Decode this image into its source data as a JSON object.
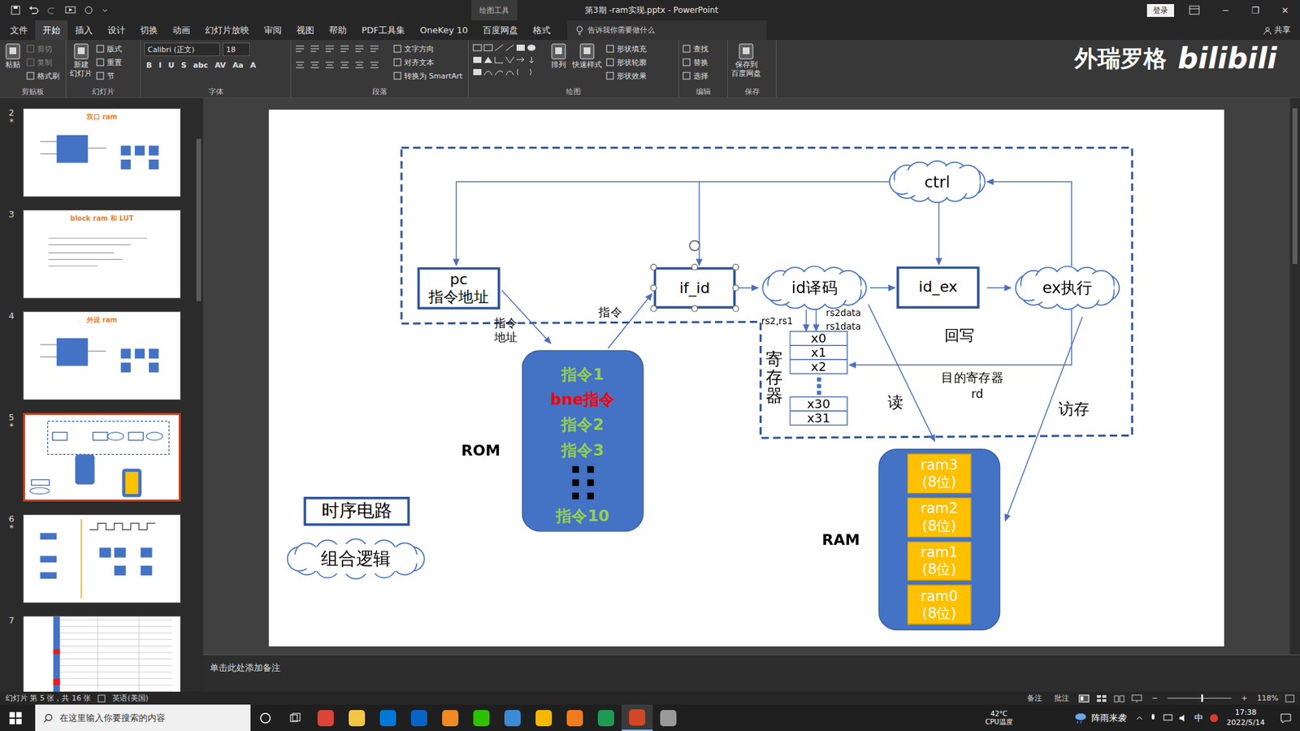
{
  "window": {
    "title": "第3期 -ram实现.pptx - PowerPoint",
    "context_tab": "绘图工具",
    "login": "登录",
    "controls": [
      "─",
      "❐",
      "✕"
    ]
  },
  "tabs": [
    {
      "label": "文件",
      "selected": false
    },
    {
      "label": "开始",
      "selected": true
    },
    {
      "label": "插入",
      "selected": false
    },
    {
      "label": "设计",
      "selected": false
    },
    {
      "label": "切换",
      "selected": false
    },
    {
      "label": "动画",
      "selected": false
    },
    {
      "label": "幻灯片放映",
      "selected": false
    },
    {
      "label": "审阅",
      "selected": false
    },
    {
      "label": "视图",
      "selected": false
    },
    {
      "label": "帮助",
      "selected": false
    },
    {
      "label": "PDF工具集",
      "selected": false
    },
    {
      "label": "OneKey 10",
      "selected": false
    },
    {
      "label": "百度网盘",
      "selected": false
    },
    {
      "label": "格式",
      "selected": false
    }
  ],
  "search": {
    "placeholder": "告诉我你需要做什么"
  },
  "share": "共享",
  "ribbon": [
    {
      "label": "剪贴板",
      "large": [
        {
          "lines": [
            "粘贴"
          ]
        }
      ],
      "small": [
        {
          "label": "剪切",
          "disabled": true
        },
        {
          "label": "复制",
          "disabled": true
        },
        {
          "label": "格式刷",
          "disabled": false
        }
      ]
    },
    {
      "label": "幻灯片",
      "large": [
        {
          "lines": [
            "新建",
            "幻灯片"
          ]
        }
      ],
      "small": [
        {
          "label": "版式",
          "disabled": false
        },
        {
          "label": "重置",
          "disabled": false
        },
        {
          "label": "节",
          "disabled": false
        }
      ]
    },
    {
      "label": "字体",
      "font": {
        "name": "Calibri (正文)",
        "size": "18",
        "styles": [
          "B",
          "I",
          "U",
          "S",
          "abc",
          "AV",
          "Aa",
          "A"
        ]
      },
      "large": [],
      "small": []
    },
    {
      "label": "段落",
      "large": [],
      "small": [
        {
          "label": "文字方向",
          "disabled": false
        },
        {
          "label": "对齐文本",
          "disabled": false
        },
        {
          "label": "转换为 SmartArt",
          "disabled": false
        }
      ]
    },
    {
      "label": "绘图",
      "large": [
        {
          "lines": [
            "排列"
          ]
        },
        {
          "lines": [
            "快速样式"
          ]
        }
      ],
      "small": [
        {
          "label": "形状填充",
          "disabled": false
        },
        {
          "label": "形状轮廓",
          "disabled": false
        },
        {
          "label": "形状效果",
          "disabled": false
        }
      ]
    },
    {
      "label": "编辑",
      "large": [],
      "small": [
        {
          "label": "查找",
          "disabled": false
        },
        {
          "label": "替换",
          "disabled": false
        },
        {
          "label": "选择",
          "disabled": false
        }
      ]
    },
    {
      "label": "保存",
      "large": [
        {
          "lines": [
            "保存到",
            "百度网盘"
          ]
        }
      ],
      "small": []
    }
  ],
  "watermark": {
    "author": "外瑞罗格",
    "logo": "bilibili"
  },
  "thumbnails": [
    {
      "number": "2",
      "mark": "*",
      "title": "双口 ram",
      "kind": "diagram",
      "selected": false
    },
    {
      "number": "3",
      "mark": "",
      "title": "block ram 和 LUT",
      "kind": "text",
      "selected": false
    },
    {
      "number": "4",
      "mark": "",
      "title": "外设 ram",
      "kind": "diagram",
      "selected": false
    },
    {
      "number": "5",
      "mark": "*",
      "kind": "cpu",
      "selected": true
    },
    {
      "number": "6",
      "mark": "*",
      "kind": "timing",
      "selected": false
    },
    {
      "number": "7",
      "mark": "",
      "kind": "table",
      "selected": false
    }
  ],
  "slide": {
    "boxes": [
      {
        "label": "pc",
        "sub": "指令地址",
        "selected": false
      },
      {
        "label": "if_id",
        "sub": "",
        "selected": true
      },
      {
        "label": "id_ex",
        "sub": "",
        "selected": false
      }
    ],
    "clouds": [
      {
        "label": "ctrl"
      },
      {
        "label": "id译码"
      },
      {
        "label": "ex执行"
      }
    ],
    "labels": [
      "指令",
      "地址",
      "指令",
      "rs2,rs1",
      "rs2data",
      "rs1data",
      "回写",
      "目的寄存器",
      "rd",
      "读",
      "访存"
    ],
    "registers": {
      "title": "寄存器",
      "cells": [
        {
          "label": "x0",
          "kind": "cell"
        },
        {
          "label": "x1",
          "kind": "cell"
        },
        {
          "label": "x2",
          "kind": "cell"
        },
        {
          "kind": "gap"
        },
        {
          "label": "x30",
          "kind": "cell"
        },
        {
          "label": "x31",
          "kind": "cell"
        }
      ]
    },
    "rom": {
      "title": "ROM",
      "items": [
        {
          "label": "指令1",
          "kind": "text",
          "color": "#92d050"
        },
        {
          "label": "bne指令",
          "kind": "text",
          "color": "#ff0000"
        },
        {
          "label": "指令2",
          "kind": "text",
          "color": "#92d050"
        },
        {
          "label": "指令3",
          "kind": "text",
          "color": "#92d050"
        },
        {
          "kind": "gap",
          "color": "#000000"
        },
        {
          "label": "指令10",
          "kind": "text",
          "color": "#92d050"
        }
      ]
    },
    "ram": {
      "title": "RAM",
      "items": [
        {
          "label": "ram3",
          "sub": "(8位)"
        },
        {
          "label": "ram2",
          "sub": "(8位)"
        },
        {
          "label": "ram1",
          "sub": "(8位)"
        },
        {
          "label": "ram0",
          "sub": "(8位)"
        }
      ]
    },
    "legend": [
      {
        "label": "时序电路",
        "kind": "box"
      },
      {
        "label": "组合逻辑",
        "kind": "cloud"
      }
    ]
  },
  "notes": {
    "placeholder": "单击此处添加备注"
  },
  "status_bar": {
    "slide": "幻灯片 第 5 张，共 16 张",
    "language": "英语(美国)",
    "notes": "备注",
    "comments": "批注",
    "minus": "−",
    "plus": "+",
    "zoom": "118%",
    "zoom_level": 0.52
  },
  "taskbar": {
    "search": "在这里输入你要搜索的内容",
    "apps": [
      {
        "selected": false,
        "color": "#db4437"
      },
      {
        "selected": false,
        "color": "#f4c542"
      },
      {
        "selected": false,
        "color": "#0078d7"
      },
      {
        "selected": false,
        "color": "#0a64c8"
      },
      {
        "selected": false,
        "color": "#f08a24"
      },
      {
        "selected": false,
        "color": "#2dc100"
      },
      {
        "selected": false,
        "color": "#3b8bd6"
      },
      {
        "selected": false,
        "color": "#f5b800"
      },
      {
        "selected": false,
        "color": "#f07b1f"
      },
      {
        "selected": false,
        "color": "#1e9a55"
      },
      {
        "selected": true,
        "color": "#d24726"
      },
      {
        "selected": false,
        "color": "#9a9a9a"
      }
    ],
    "cpu_temp": "42°C",
    "cpu_label": "CPU温度",
    "weather": "阵雨来袭",
    "ime": "中",
    "time": "17:38",
    "date": "2022/5/14"
  }
}
